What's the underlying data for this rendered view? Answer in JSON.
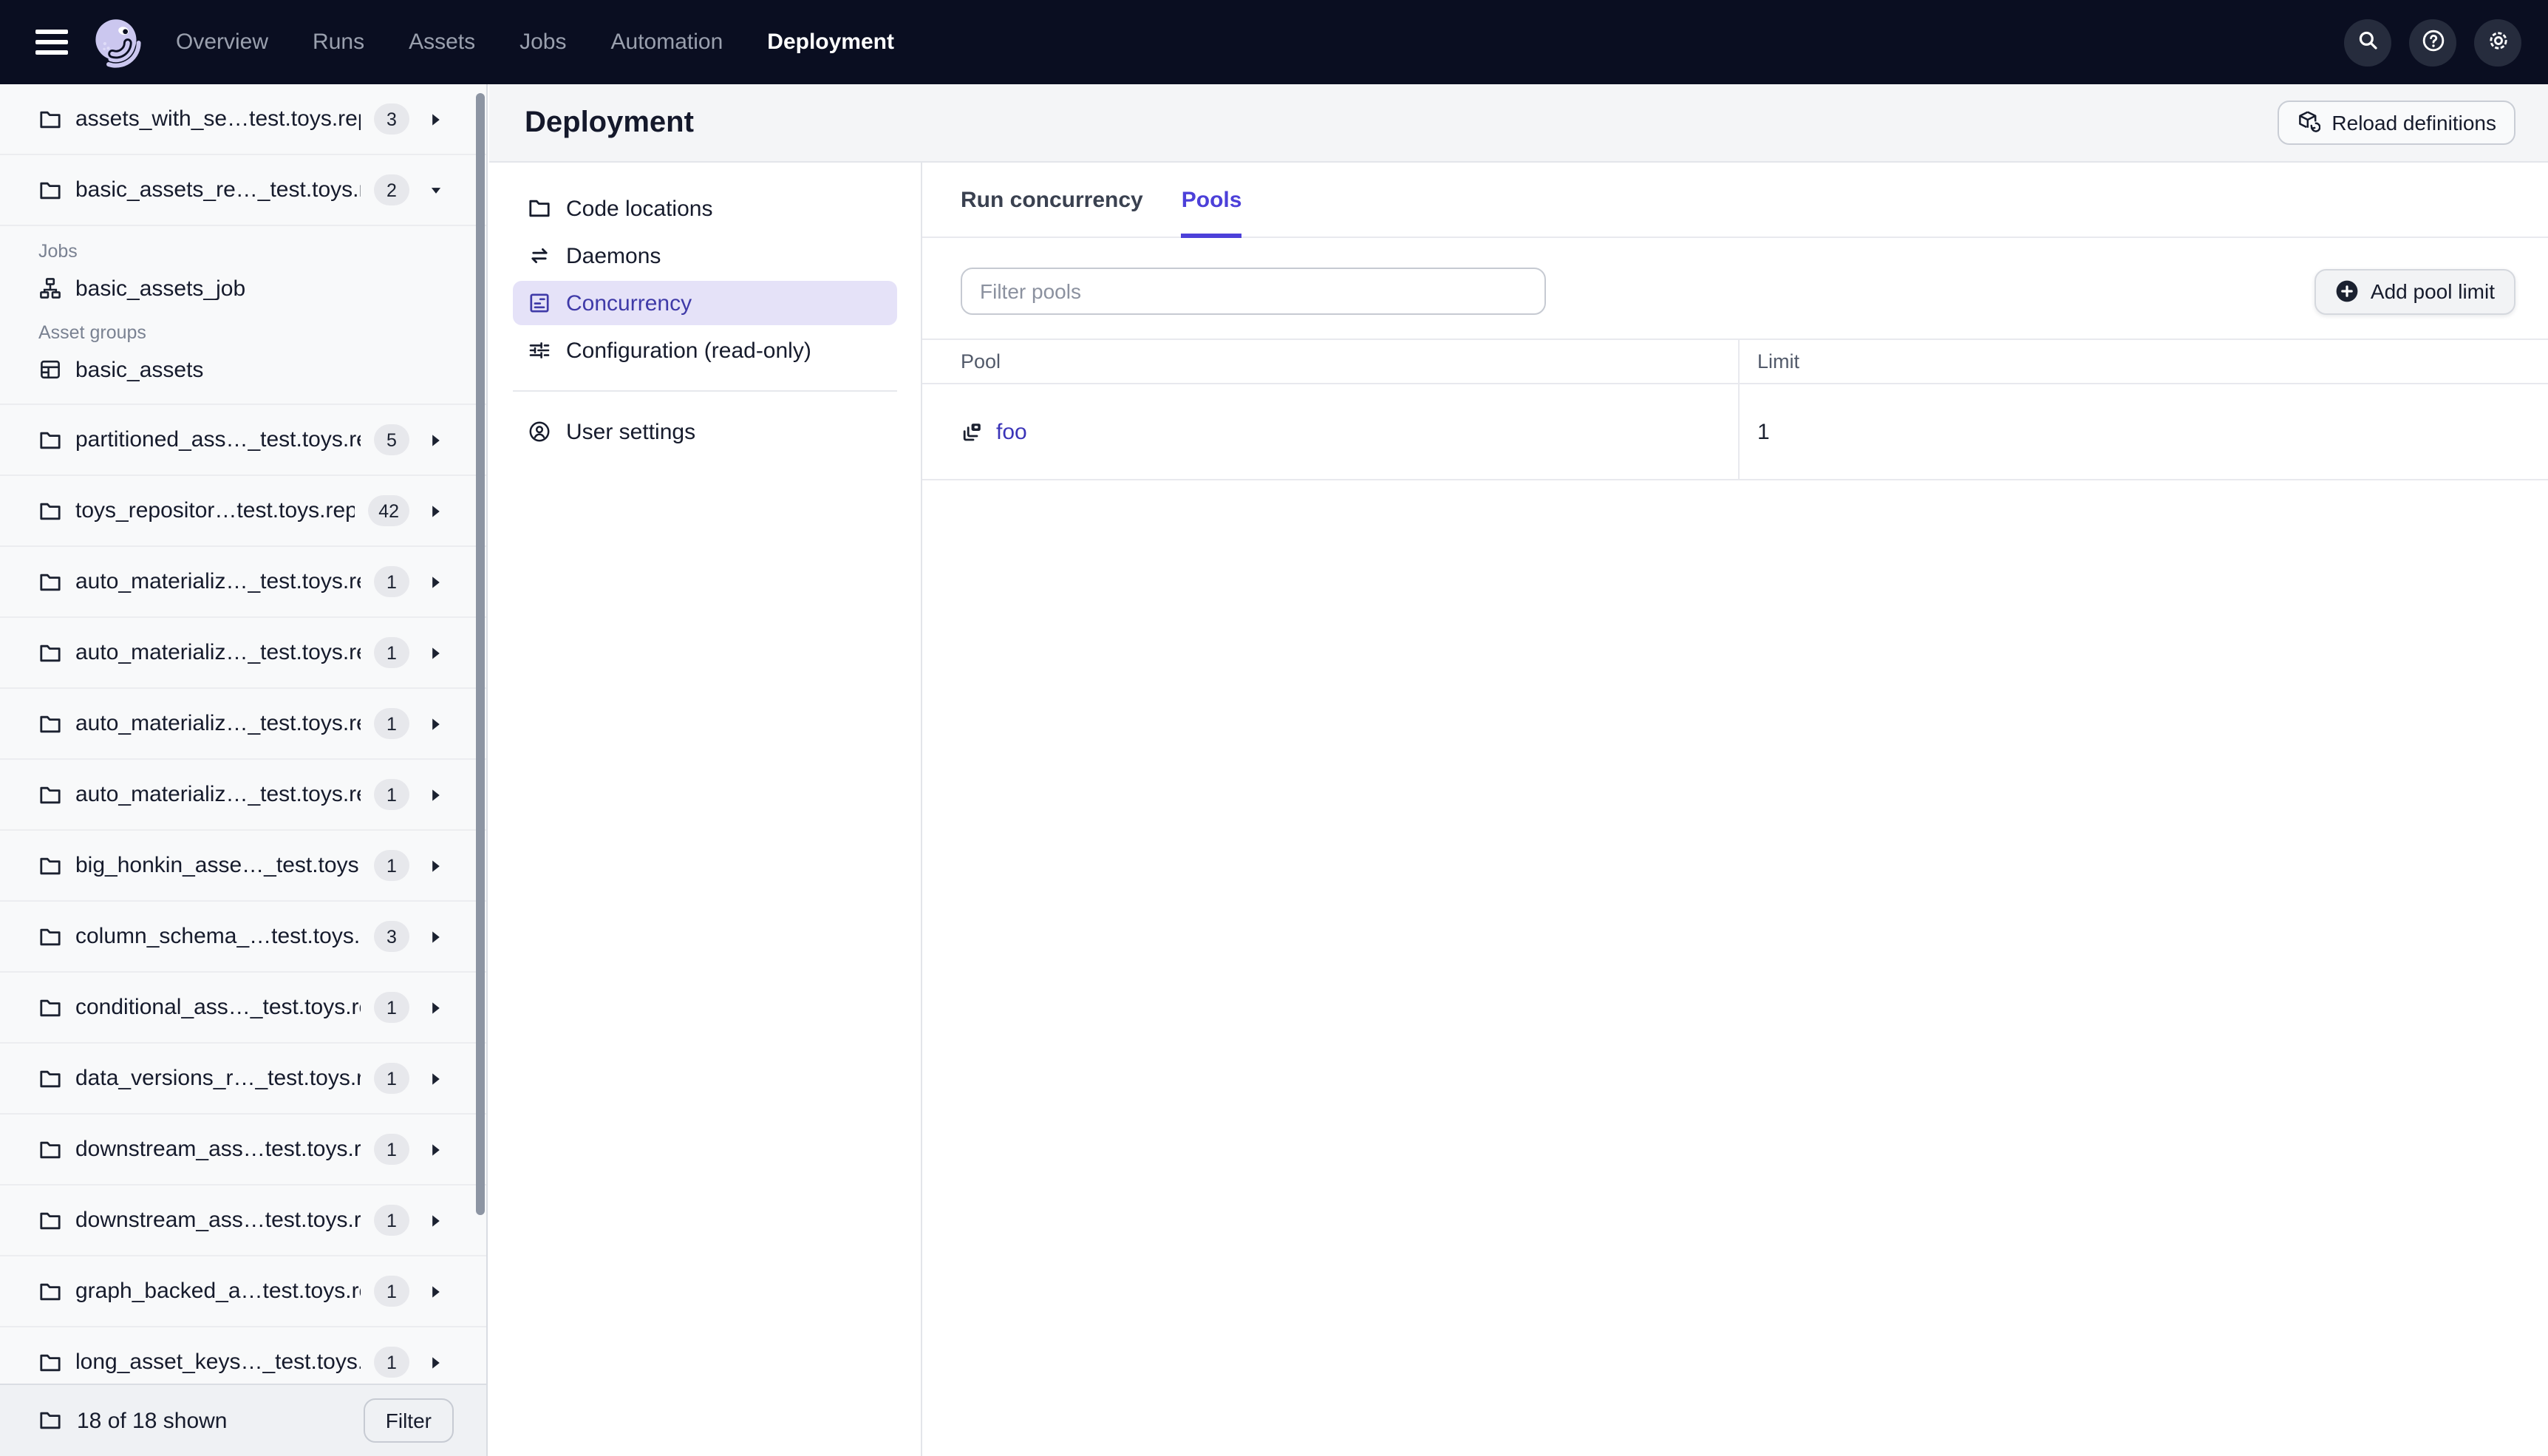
{
  "topnav": {
    "items": [
      {
        "label": "Overview",
        "active": false
      },
      {
        "label": "Runs",
        "active": false
      },
      {
        "label": "Assets",
        "active": false
      },
      {
        "label": "Jobs",
        "active": false
      },
      {
        "label": "Automation",
        "active": false
      },
      {
        "label": "Deployment",
        "active": true
      }
    ],
    "icon_buttons": [
      {
        "icon": "search-icon"
      },
      {
        "icon": "help-icon"
      },
      {
        "icon": "gear-icon"
      }
    ]
  },
  "sidebar": {
    "items": [
      {
        "label": "assets_with_se…test.toys.repo",
        "badge": "3",
        "state": "collapsed"
      },
      {
        "label": "basic_assets_re…_test.toys.rep",
        "badge": "2",
        "state": "expanded",
        "sections": [
          {
            "heading": "Jobs",
            "icon": "job",
            "entries": [
              "basic_assets_job"
            ]
          },
          {
            "heading": "Asset groups",
            "icon": "asset-group",
            "entries": [
              "basic_assets"
            ]
          }
        ]
      },
      {
        "label": "partitioned_ass…_test.toys.rep",
        "badge": "5",
        "state": "collapsed"
      },
      {
        "label": "toys_repositor…test.toys.repo",
        "badge": "42",
        "state": "collapsed"
      },
      {
        "label": "auto_materializ…_test.toys.repo",
        "badge": "1",
        "state": "collapsed"
      },
      {
        "label": "auto_materializ…_test.toys.repo",
        "badge": "1",
        "state": "collapsed"
      },
      {
        "label": "auto_materializ…_test.toys.repo",
        "badge": "1",
        "state": "collapsed"
      },
      {
        "label": "auto_materializ…_test.toys.repo",
        "badge": "1",
        "state": "collapsed"
      },
      {
        "label": "big_honkin_asse…_test.toys.rep",
        "badge": "1",
        "state": "collapsed"
      },
      {
        "label": "column_schema_…test.toys.rep",
        "badge": "3",
        "state": "collapsed"
      },
      {
        "label": "conditional_ass…_test.toys.repo",
        "badge": "1",
        "state": "collapsed"
      },
      {
        "label": "data_versions_r…_test.toys.rep",
        "badge": "1",
        "state": "collapsed"
      },
      {
        "label": "downstream_ass…test.toys.rep",
        "badge": "1",
        "state": "collapsed"
      },
      {
        "label": "downstream_ass…test.toys.rep",
        "badge": "1",
        "state": "collapsed"
      },
      {
        "label": "graph_backed_a…test.toys.repo",
        "badge": "1",
        "state": "collapsed"
      },
      {
        "label": "long_asset_keys…_test.toys.re",
        "badge": "1",
        "state": "collapsed"
      }
    ],
    "footer": {
      "count_text": "18 of 18 shown",
      "filter_label": "Filter"
    }
  },
  "header": {
    "title": "Deployment",
    "reload_label": "Reload definitions"
  },
  "secondary_nav": {
    "items": [
      {
        "label": "Code locations",
        "icon": "folder",
        "active": false
      },
      {
        "label": "Daemons",
        "icon": "swap",
        "active": false
      },
      {
        "label": "Concurrency",
        "icon": "concurrency",
        "active": true
      },
      {
        "label": "Configuration (read-only)",
        "icon": "sliders",
        "active": false
      }
    ],
    "user_settings": {
      "label": "User settings",
      "icon": "user"
    }
  },
  "tabs": [
    {
      "label": "Run concurrency",
      "active": false
    },
    {
      "label": "Pools",
      "active": true
    }
  ],
  "pools": {
    "filter_placeholder": "Filter pools",
    "add_label": "Add pool limit",
    "table": {
      "columns": [
        "Pool",
        "Limit"
      ],
      "rows": [
        {
          "pool": "foo",
          "limit": "1",
          "icon": "pool-layers"
        }
      ]
    }
  },
  "colors": {
    "topnav_bg": "#0A0E21",
    "nav_inactive": "#9AA0AE",
    "nav_icon_circle": "#262C3D",
    "logo_lavender": "#CBC7EF",
    "accent": "#4C40D9",
    "selected_bg": "#E5E2F8",
    "selected_text": "#3F3AA8",
    "link": "#3B34B8",
    "badge_bg": "#E7E8EC",
    "sidebar_bg": "#F8F9FA",
    "header_band": "#F4F5F7",
    "border": "#E8E9EE",
    "text": "#161B2C",
    "muted": "#7A8292"
  }
}
